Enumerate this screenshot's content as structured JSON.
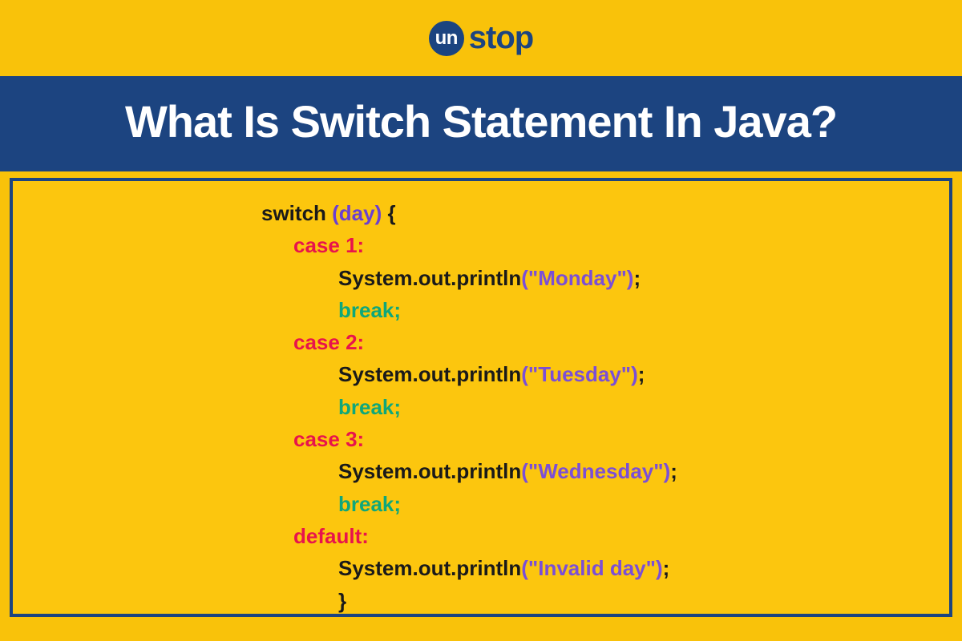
{
  "logo": {
    "circle_text": "un",
    "word": "stop"
  },
  "title": "What Is Switch Statement In Java?",
  "code": {
    "switch_kw": "switch ",
    "switch_var": "(day) ",
    "open_brace": "{",
    "cases": [
      {
        "label": "case 1:",
        "call": "System.out.println",
        "str": "(\"Monday\")",
        "semi": ";",
        "brk": "break;"
      },
      {
        "label": "case 2:",
        "call": "System.out.println",
        "str": "(\"Tuesday\")",
        "semi": ";",
        "brk": "break;"
      },
      {
        "label": "case 3:",
        "call": "System.out.println",
        "str": "(\"Wednesday\")",
        "semi": ";",
        "brk": "break;"
      }
    ],
    "default_label": "default:",
    "default_call": "System.out.println",
    "default_str": "(\"Invalid day\")",
    "default_semi": ";",
    "close_brace": "}"
  }
}
